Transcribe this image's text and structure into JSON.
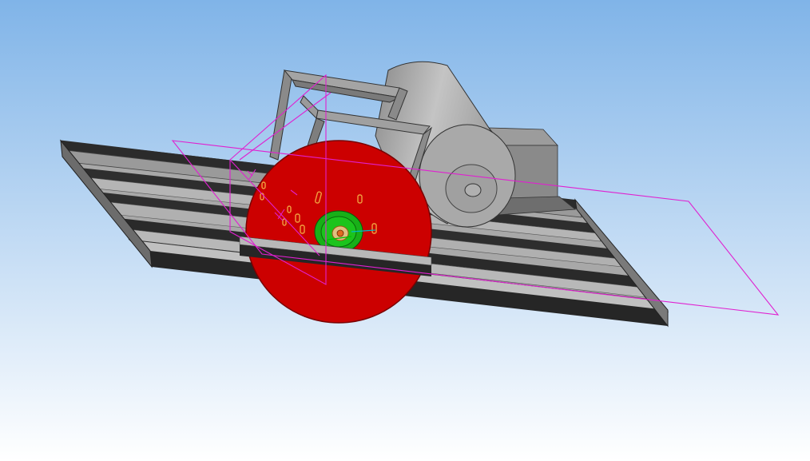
{
  "viewport": {
    "background_top": "#80b4e8",
    "background_bottom": "#ffffff"
  },
  "model": {
    "colors": {
      "frame_dark": "#2a2a2a",
      "frame_mid": "#8c8c8c",
      "frame_light": "#b8b8b8",
      "motor": "#a6a6a6",
      "blade": "#cc0000",
      "blade_edge": "#7a0000",
      "hub": "#18b018",
      "hub_inner": "#0a6a0a",
      "plane": "#e020d0",
      "axis_green": "#00c000",
      "axis_cyan": "#00b8c8",
      "bolt": "#e08a20"
    },
    "icons": [
      "datum-plane",
      "saw-blade",
      "motor",
      "rail-frame",
      "guard-frame"
    ]
  }
}
